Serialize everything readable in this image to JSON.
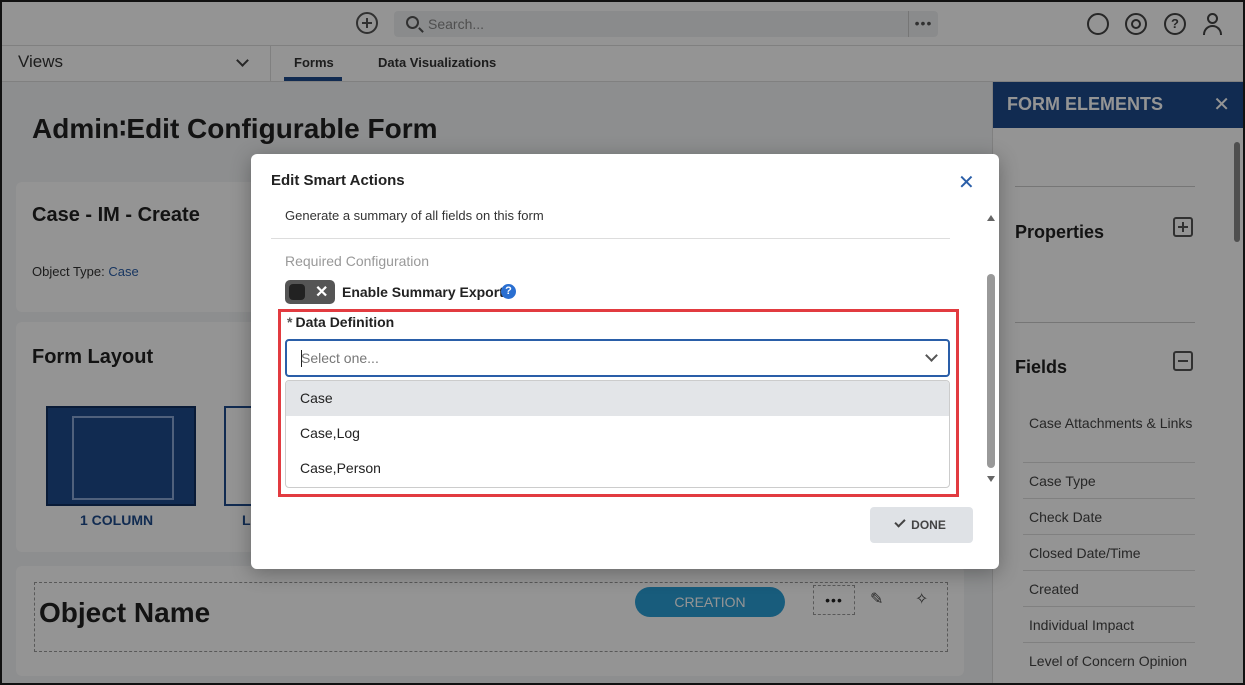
{
  "topbar": {
    "search_placeholder": "Search...",
    "more": "•••"
  },
  "subbar": {
    "views_label": "Views",
    "tabs": [
      {
        "label": "Forms",
        "active": true
      },
      {
        "label": "Data Visualizations",
        "active": false
      }
    ]
  },
  "page": {
    "title": "Admin∶Edit Configurable Form",
    "card1_title": "Case - IM - Create",
    "object_type_label": "Object Type:",
    "object_type_value": "Case",
    "form_layout_title": "Form Layout",
    "layout_option_1": "1 COLUMN",
    "layout_option_2": "L",
    "object_name": "Object Name",
    "creation_badge": "CREATION",
    "more": "•••"
  },
  "right_panel": {
    "title": "FORM ELEMENTS",
    "properties_label": "Properties",
    "fields_label": "Fields",
    "fields": [
      "Case Attachments & Links",
      "Case Type",
      "Check Date",
      "Closed Date/Time",
      "Created",
      "Individual Impact",
      "Level of Concern Opinion"
    ]
  },
  "modal": {
    "title": "Edit Smart Actions",
    "description": "Generate a summary of all fields on this form",
    "required_config": "Required Configuration",
    "toggle_label": "Enable Summary Export",
    "toggle_state": "off",
    "data_definition_label": "Data Definition",
    "select_placeholder": "Select one...",
    "options": [
      "Case",
      "Case,Log",
      "Case,Person"
    ],
    "highlighted_option": "Case",
    "done_label": "DONE"
  },
  "colors": {
    "brand_navy": "#1e4b8c",
    "accent_blue": "#2a5ea8",
    "highlight_red": "#e23b40",
    "badge_teal": "#2a9fd6"
  }
}
